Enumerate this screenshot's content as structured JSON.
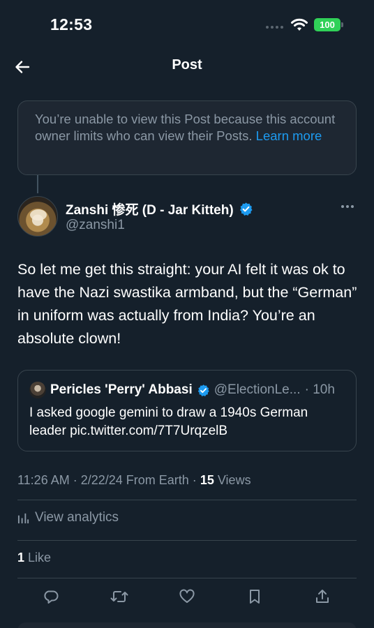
{
  "status_bar": {
    "time": "12:53",
    "battery": "100"
  },
  "nav": {
    "title": "Post"
  },
  "notice": {
    "text": "You’re unable to view this Post because this account owner limits who can view their Posts.",
    "link": "Learn more"
  },
  "post": {
    "author_name": "Zanshi 惨死 (D - Jar Kitteh)",
    "author_handle": "@zanshi1",
    "body": "So let me get this straight: your AI felt it was ok to have the Nazi swastika armband, but the “German” in uniform was actually from India? You’re an absolute clown!",
    "quote": {
      "author_name": "Pericles 'Perry' Abbasi",
      "author_handle": "@ElectionLe...",
      "time": "· 10h",
      "body": "I asked google gemini to draw a 1940s German leader pic.twitter.com/7T7UrqzelB"
    },
    "meta": {
      "time": "11:26 AM",
      "date": "· 2/22/24 From Earth ·",
      "views_count": "15",
      "views_label": "Views"
    },
    "analytics_label": "View analytics",
    "likes_count": "1",
    "likes_label": "Like"
  },
  "colors": {
    "background": "#15202b",
    "accent": "#1d9bf0",
    "muted": "#8b98a5",
    "border": "#38444d"
  },
  "icons": [
    "back-arrow-icon",
    "wifi-icon",
    "verified-badge-icon",
    "more-icon",
    "analytics-icon",
    "reply-icon",
    "retweet-icon",
    "like-icon",
    "bookmark-icon",
    "share-icon"
  ]
}
